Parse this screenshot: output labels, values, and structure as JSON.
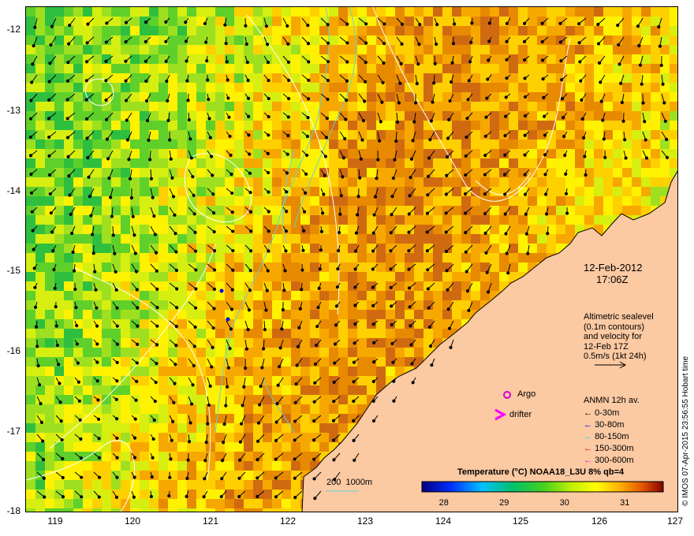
{
  "map": {
    "lon_range": [
      118.6,
      127.0
    ],
    "lat_range": [
      -18.0,
      -11.7
    ],
    "x_ticks": [
      "119",
      "120",
      "121",
      "122",
      "123",
      "124",
      "125",
      "126",
      "127"
    ],
    "y_ticks": [
      "-12",
      "-13",
      "-14",
      "-15",
      "-16",
      "-17",
      "-18"
    ]
  },
  "datetime": {
    "date": "12-Feb-2012",
    "time": "17:06Z"
  },
  "altimetry_note": {
    "line1": "Altimetric sealevel",
    "line2": "(0.1m contours)",
    "line3": "and velocity for",
    "line4": "12-Feb 17Z",
    "line5": "0.5m/s (1kt 24h)"
  },
  "legend_markers": {
    "argo": "Argo",
    "drifter": "drifter"
  },
  "anmn": {
    "title": "ANMN 12h av.",
    "items": [
      {
        "label": "0-30m",
        "color": "#000000"
      },
      {
        "label": "30-80m",
        "color": "#0000ff"
      },
      {
        "label": "80-150m",
        "color": "#00e5e5"
      },
      {
        "label": "150-300m",
        "color": "#ff0000"
      },
      {
        "label": "300-600m",
        "color": "#ff00ff"
      }
    ]
  },
  "bathymetry_label": "200  1000m",
  "colorbar": {
    "title": "Temperature (°C) NOAA18_L3U 8% qb=4",
    "ticks": [
      "28",
      "29",
      "30",
      "31"
    ],
    "range": [
      27.6,
      31.6
    ]
  },
  "credit": "© IMOS 07-Apr-2015 23:56:55 Hobart time",
  "colors": {
    "land": "#fbc9a2",
    "contour": "#ffffff",
    "isobath": "#5fd4d4",
    "argo": "#d400d4",
    "drifter": "#ff00ff"
  }
}
